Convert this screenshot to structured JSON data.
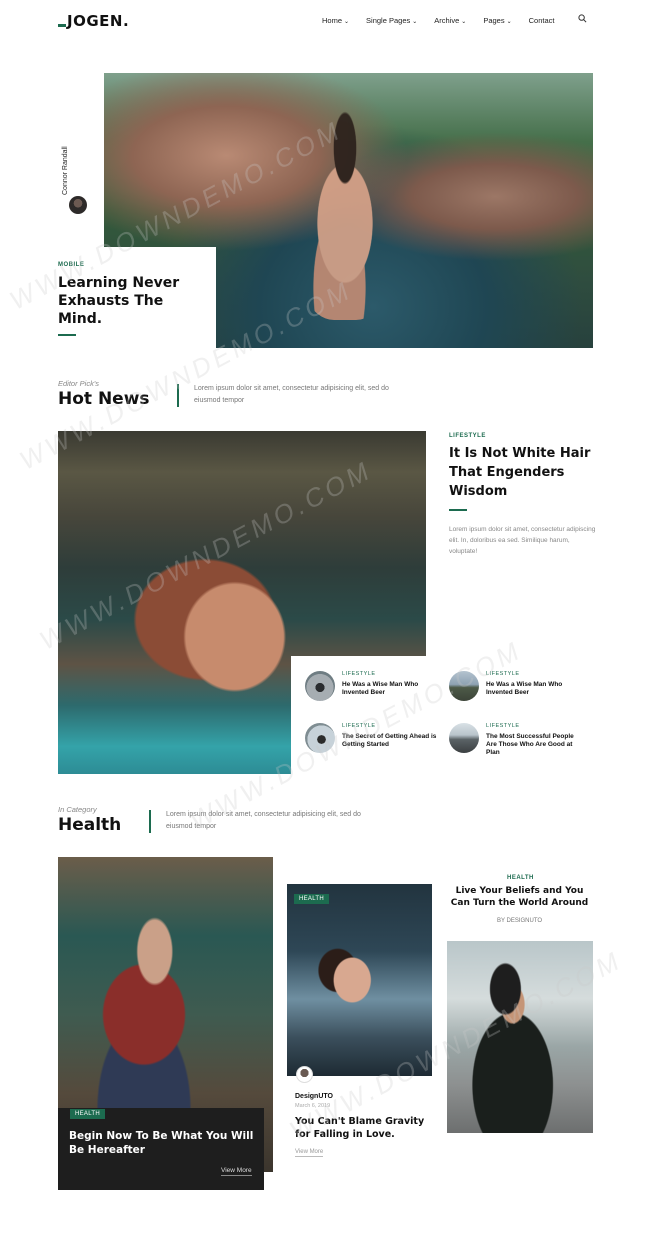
{
  "header": {
    "logo": "JOGEN.",
    "nav": [
      {
        "label": "Home",
        "dropdown": true
      },
      {
        "label": "Single Pages",
        "dropdown": true
      },
      {
        "label": "Archive",
        "dropdown": true
      },
      {
        "label": "Pages",
        "dropdown": true
      },
      {
        "label": "Contact",
        "dropdown": false
      }
    ],
    "search_icon": "search-icon"
  },
  "hero": {
    "author": "Connor Randall",
    "category": "MOBILE",
    "title": "Learning Never Exhausts The Mind."
  },
  "hot_news": {
    "subtitle": "Editor Pick's",
    "title": "Hot News",
    "description": "Lorem ipsum dolor sit amet, consectetur adipisicing elit, sed do eiusmod tempor",
    "feature": {
      "category": "LIFESTYLE",
      "title": "It Is Not White Hair That Engenders Wisdom",
      "excerpt": "Lorem ipsum dolor sit amet, consectetur adipiscing elit. In, doloribus ea sed. Similique harum, voluptate!"
    },
    "mini_posts": [
      {
        "category": "LIFESTYLE",
        "title": "He Was a Wise Man Who Invented Beer"
      },
      {
        "category": "LIFESTYLE",
        "title": "He Was a Wise Man Who Invented Beer"
      },
      {
        "category": "LIFESTYLE",
        "title": "The Secret of Getting Ahead is Getting Started"
      },
      {
        "category": "LIFESTYLE",
        "title": "The Most Successful People Are Those Who Are Good at Plan"
      }
    ]
  },
  "health": {
    "subtitle": "In Category",
    "title": "Health",
    "description": "Lorem ipsum dolor sit amet, consectetur adipisicing elit, sed do eiusmod tempor",
    "card1": {
      "badge": "HEALTH",
      "title": "Begin Now To Be What You Will Be Hereafter",
      "more": "View More"
    },
    "card2": {
      "badge": "HEALTH",
      "author": "DesignUTO",
      "date": "March 6, 2019",
      "title": "You Can't Blame Gravity for Falling in Love.",
      "more": "View More"
    },
    "card3": {
      "category": "HEALTH",
      "title": "Live Your Beliefs and You Can Turn the World Around",
      "author": "BY DESIGNUTO"
    }
  },
  "watermark": "WWW.DOWNDEMO.COM",
  "colors": {
    "accent": "#1c6b4f",
    "dark_card": "#1e1e1e"
  }
}
